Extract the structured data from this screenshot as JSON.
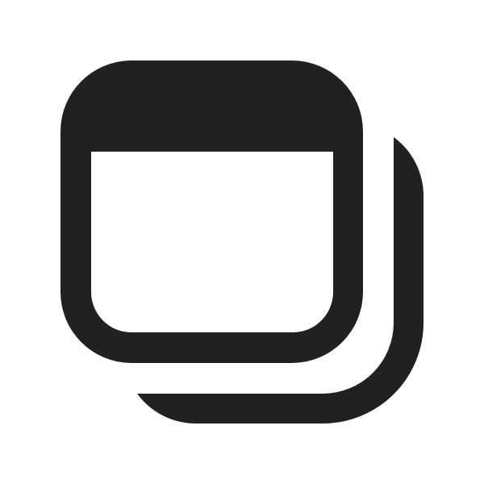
{
  "icon": {
    "name": "multiple-windows-icon",
    "color": "#212121",
    "background": "#ffffff"
  }
}
